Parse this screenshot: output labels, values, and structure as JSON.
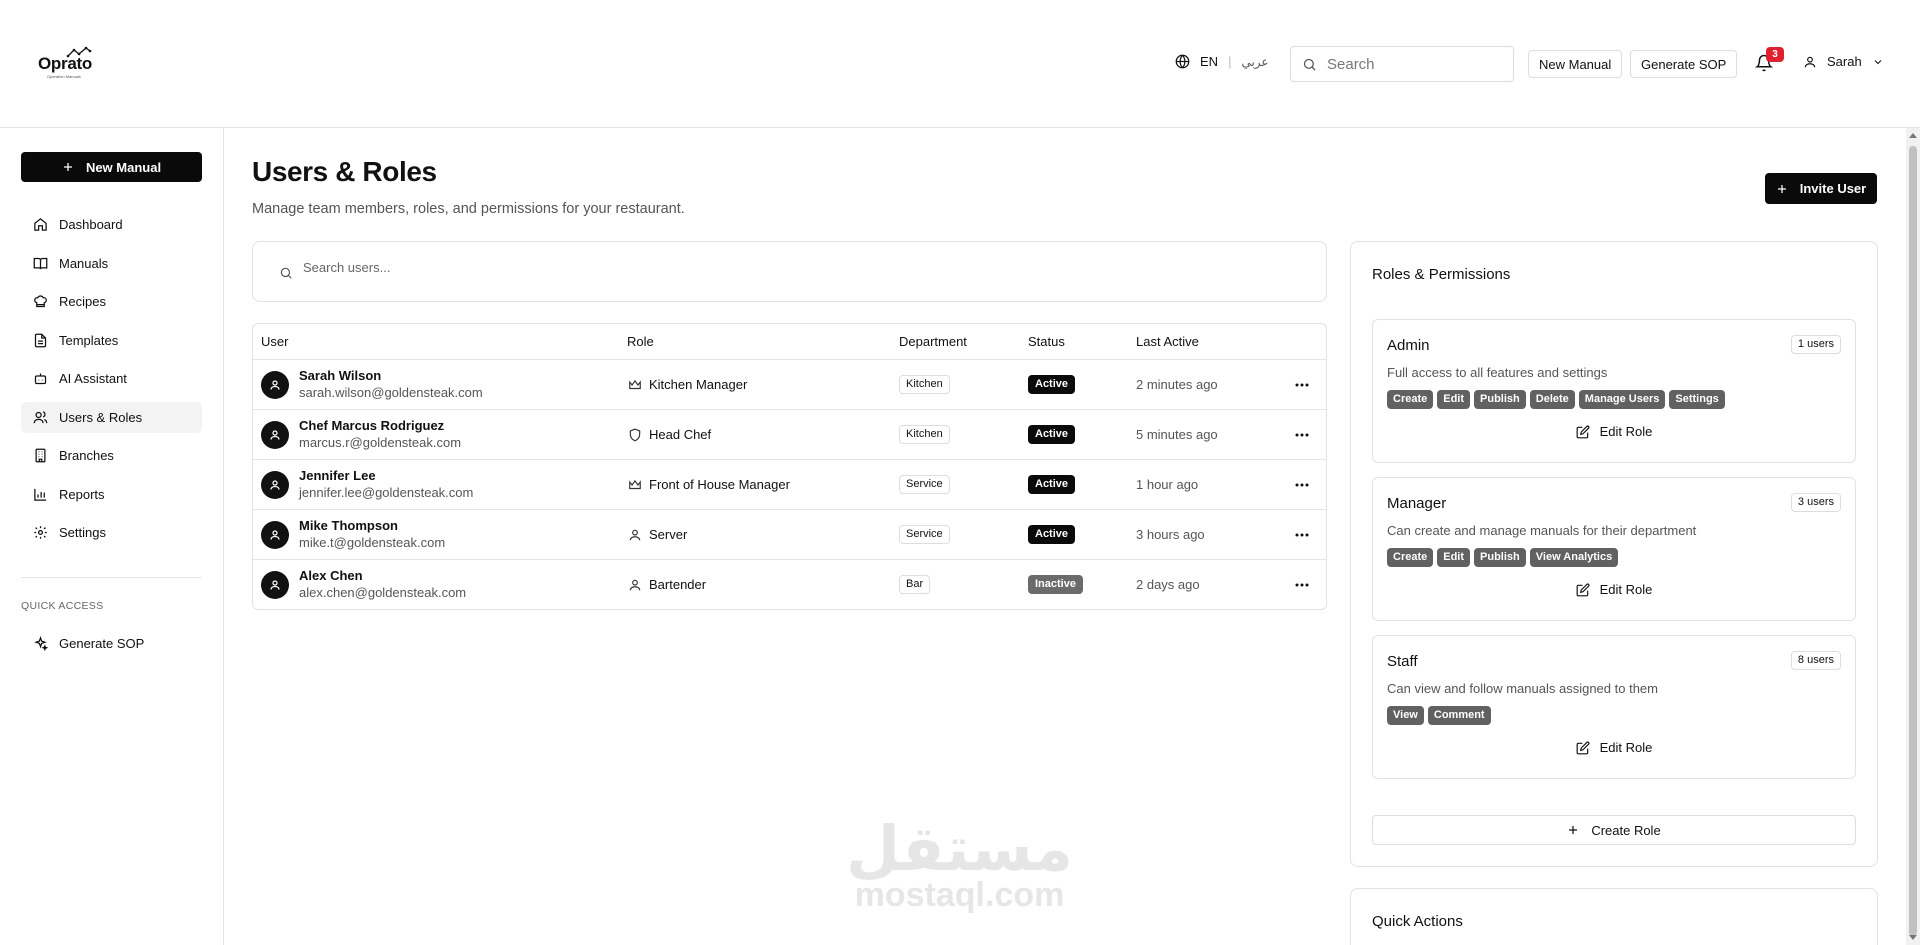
{
  "header": {
    "logo_text": "Oprato",
    "logo_subtext": "Operation Manuals",
    "lang_en": "EN",
    "lang_ar": "عربي",
    "search_placeholder": "Search",
    "new_manual_label": "New Manual",
    "generate_sop_label": "Generate SOP",
    "notification_count": "3",
    "user_name": "Sarah"
  },
  "sidebar": {
    "new_manual_label": "New Manual",
    "items": [
      {
        "label": "Dashboard",
        "icon": "home-icon"
      },
      {
        "label": "Manuals",
        "icon": "book-open-icon"
      },
      {
        "label": "Recipes",
        "icon": "chef-hat-icon"
      },
      {
        "label": "Templates",
        "icon": "file-text-icon"
      },
      {
        "label": "AI Assistant",
        "icon": "bot-icon"
      },
      {
        "label": "Users & Roles",
        "icon": "users-icon",
        "active": true
      },
      {
        "label": "Branches",
        "icon": "building-icon"
      },
      {
        "label": "Reports",
        "icon": "bar-chart-icon"
      },
      {
        "label": "Settings",
        "icon": "gear-icon"
      }
    ],
    "quick_access_label": "QUICK ACCESS",
    "quick_access_items": [
      {
        "label": "Generate SOP",
        "icon": "sparkles-icon"
      }
    ]
  },
  "main": {
    "title": "Users & Roles",
    "subtitle": "Manage team members, roles, and permissions for your restaurant.",
    "invite_label": "Invite User",
    "search_placeholder": "Search users...",
    "columns": [
      "User",
      "Role",
      "Department",
      "Status",
      "Last Active"
    ],
    "users": [
      {
        "name": "Sarah Wilson",
        "email": "sarah.wilson@goldensteak.com",
        "role": "Kitchen Manager",
        "role_icon": "crown-icon",
        "department": "Kitchen",
        "status": "Active",
        "last_active": "2 minutes ago"
      },
      {
        "name": "Chef Marcus Rodriguez",
        "email": "marcus.r@goldensteak.com",
        "role": "Head Chef",
        "role_icon": "shield-icon",
        "department": "Kitchen",
        "status": "Active",
        "last_active": "5 minutes ago"
      },
      {
        "name": "Jennifer Lee",
        "email": "jennifer.lee@goldensteak.com",
        "role": "Front of House Manager",
        "role_icon": "crown-icon",
        "department": "Service",
        "status": "Active",
        "last_active": "1 hour ago"
      },
      {
        "name": "Mike Thompson",
        "email": "mike.t@goldensteak.com",
        "role": "Server",
        "role_icon": "user-icon",
        "department": "Service",
        "status": "Active",
        "last_active": "3 hours ago"
      },
      {
        "name": "Alex Chen",
        "email": "alex.chen@goldensteak.com",
        "role": "Bartender",
        "role_icon": "user-icon",
        "department": "Bar",
        "status": "Inactive",
        "last_active": "2 days ago"
      }
    ]
  },
  "roles_panel": {
    "title": "Roles & Permissions",
    "edit_role_label": "Edit Role",
    "create_role_label": "Create Role",
    "roles": [
      {
        "name": "Admin",
        "count": "1 users",
        "description": "Full access to all features and settings",
        "permissions": [
          "Create",
          "Edit",
          "Publish",
          "Delete",
          "Manage Users",
          "Settings"
        ]
      },
      {
        "name": "Manager",
        "count": "3 users",
        "description": "Can create and manage manuals for their department",
        "permissions": [
          "Create",
          "Edit",
          "Publish",
          "View Analytics"
        ]
      },
      {
        "name": "Staff",
        "count": "8 users",
        "description": "Can view and follow manuals assigned to them",
        "permissions": [
          "View",
          "Comment"
        ]
      }
    ]
  },
  "quick_actions": {
    "title": "Quick Actions"
  },
  "watermark": {
    "arabic": "مستقل",
    "latin": "mostaql.com"
  },
  "colors": {
    "primary": "#0a0a0a",
    "badge_red": "#e0202e",
    "inactive": "#6b6b6b",
    "permission_chip": "#616161",
    "border": "#e2e2e2"
  }
}
